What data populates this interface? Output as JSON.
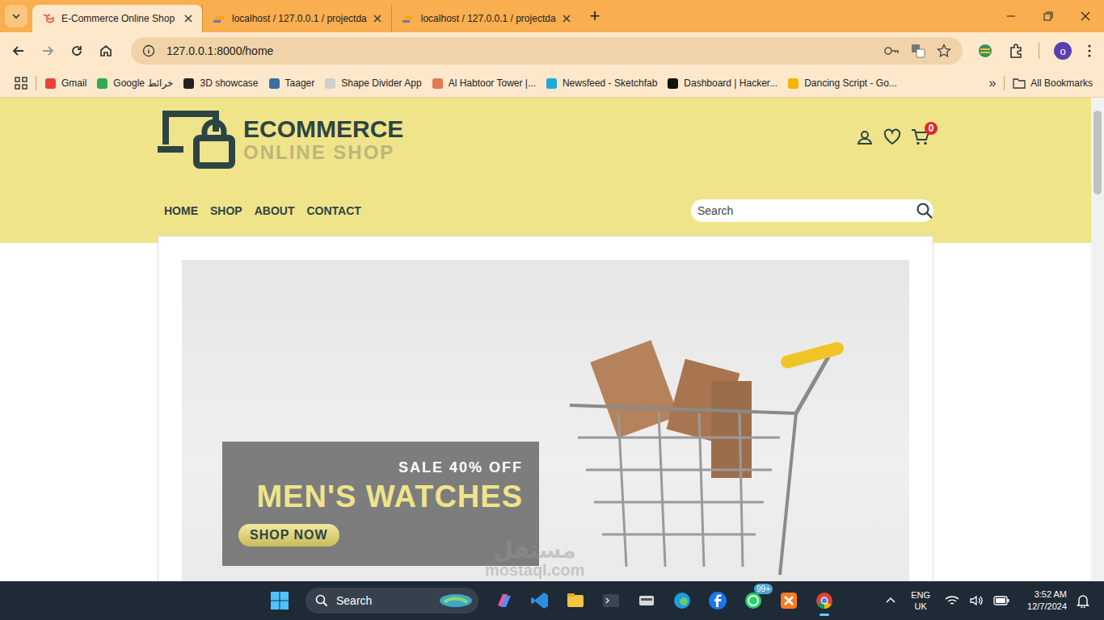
{
  "browser": {
    "tabs": [
      {
        "label": "E-Commerce Online Shop",
        "selected": true
      },
      {
        "label": "localhost / 127.0.0.1 / projectda",
        "selected": false
      },
      {
        "label": "localhost / 127.0.0.1 / projectda",
        "selected": false
      }
    ],
    "new_tab": "+",
    "address": "127.0.0.1:8000/home",
    "profile": "o",
    "bookmarks": [
      "Gmail",
      "Google خرائط",
      "3D showcase",
      "Taager",
      "Shape Divider App",
      "Al Habtoor Tower |...",
      "Newsfeed - Sketchfab",
      "Dashboard | Hacker...",
      "Dancing Script - Go..."
    ],
    "more": "»",
    "all_bookmarks": "All Bookmarks"
  },
  "site": {
    "logo": {
      "title": "ECOMMERCE",
      "subtitle": "ONLINE SHOP"
    },
    "cart_count": "0",
    "nav": [
      "HOME",
      "SHOP",
      "ABOUT",
      "CONTACT"
    ],
    "search": {
      "placeholder": "Search"
    },
    "hero": {
      "tag": "SALE 40% OFF",
      "title": "MEN'S WATCHES",
      "button": "SHOP NOW"
    }
  },
  "taskbar": {
    "search": "Search",
    "badge": "99+",
    "language": [
      "ENG",
      "UK"
    ],
    "time": "3:52 AM",
    "date": "12/7/2024"
  },
  "watermark": {
    "arabic": "مستقل",
    "latin": "mostaql.com"
  }
}
